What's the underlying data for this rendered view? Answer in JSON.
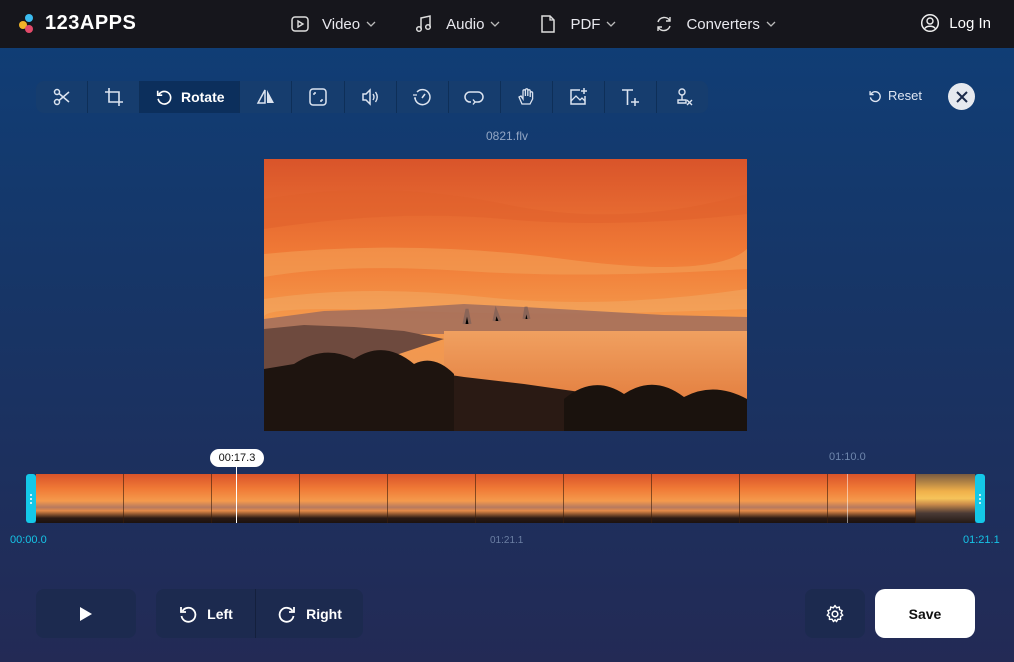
{
  "header": {
    "logo": "123APPS",
    "nav": [
      {
        "label": "Video",
        "icon": "video-icon"
      },
      {
        "label": "Audio",
        "icon": "music-note-icon"
      },
      {
        "label": "PDF",
        "icon": "document-icon"
      },
      {
        "label": "Converters",
        "icon": "convert-icon"
      }
    ],
    "login_label": "Log In"
  },
  "toolbar": {
    "tools": [
      "cut",
      "crop",
      "rotate",
      "flip",
      "resize",
      "volume",
      "speed",
      "loop",
      "stabilize",
      "add-image",
      "add-text",
      "remove-logo"
    ],
    "active_label": "Rotate",
    "reset_label": "Reset"
  },
  "file": {
    "name": "0821.flv"
  },
  "timeline": {
    "cursor_time": "00:17.3",
    "hover_time": "01:10.0",
    "start_time": "00:00.0",
    "mid_time": "01:21.1",
    "end_time": "01:21.1",
    "frame_count": 11
  },
  "controls": {
    "left_label": "Left",
    "right_label": "Right",
    "save_label": "Save"
  },
  "colors": {
    "accent": "#14c8e8",
    "header_bg": "#16161c",
    "panel_bg": "#1c2a4f"
  }
}
